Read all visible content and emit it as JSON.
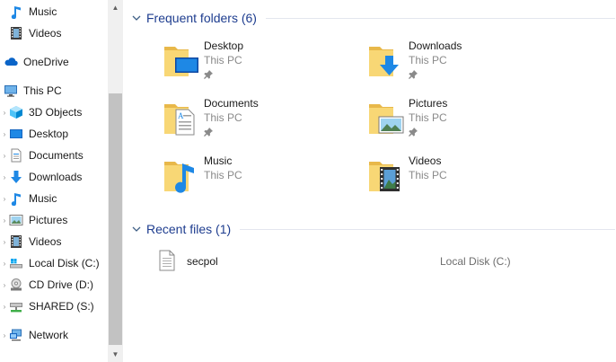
{
  "nav": {
    "items": [
      {
        "label": "Music",
        "icon": "music-note-icon",
        "expandable": false
      },
      {
        "label": "Videos",
        "icon": "film-strip-icon",
        "expandable": false
      },
      {
        "label": "OneDrive",
        "icon": "cloud-icon",
        "expandable": false
      },
      {
        "label": "This PC",
        "icon": "monitor-icon",
        "expandable": false
      },
      {
        "label": "3D Objects",
        "icon": "cube-icon",
        "expandable": true
      },
      {
        "label": "Desktop",
        "icon": "desktop-icon",
        "expandable": true
      },
      {
        "label": "Documents",
        "icon": "document-icon",
        "expandable": true
      },
      {
        "label": "Downloads",
        "icon": "download-arrow-icon",
        "expandable": true
      },
      {
        "label": "Music",
        "icon": "music-note-icon",
        "expandable": true
      },
      {
        "label": "Pictures",
        "icon": "picture-icon",
        "expandable": true
      },
      {
        "label": "Videos",
        "icon": "film-strip-icon",
        "expandable": true
      },
      {
        "label": "Local Disk (C:)",
        "icon": "hard-drive-icon",
        "expandable": true
      },
      {
        "label": "CD Drive (D:)",
        "icon": "cd-drive-icon",
        "expandable": true
      },
      {
        "label": "SHARED (S:)",
        "icon": "network-drive-icon",
        "expandable": true
      },
      {
        "label": "Network",
        "icon": "network-icon",
        "expandable": true
      }
    ]
  },
  "frequent": {
    "title": "Frequent folders (6)",
    "folders": [
      {
        "name": "Desktop",
        "location": "This PC",
        "pinned": true,
        "icon": "desktop-folder-icon"
      },
      {
        "name": "Downloads",
        "location": "This PC",
        "pinned": true,
        "icon": "downloads-folder-icon"
      },
      {
        "name": "Documents",
        "location": "This PC",
        "pinned": true,
        "icon": "documents-folder-icon"
      },
      {
        "name": "Pictures",
        "location": "This PC",
        "pinned": true,
        "icon": "pictures-folder-icon"
      },
      {
        "name": "Music",
        "location": "This PC",
        "pinned": false,
        "icon": "music-folder-icon"
      },
      {
        "name": "Videos",
        "location": "This PC",
        "pinned": false,
        "icon": "videos-folder-icon"
      }
    ]
  },
  "recent": {
    "title": "Recent files (1)",
    "files": [
      {
        "name": "secpol",
        "location": "Local Disk (C:)",
        "icon": "file-icon"
      }
    ]
  },
  "colors": {
    "section_title": "#1e3d8f",
    "folder_yellow": "#f8d775",
    "accent_blue": "#1e88e5",
    "secondary_text": "#8a8a8a"
  }
}
